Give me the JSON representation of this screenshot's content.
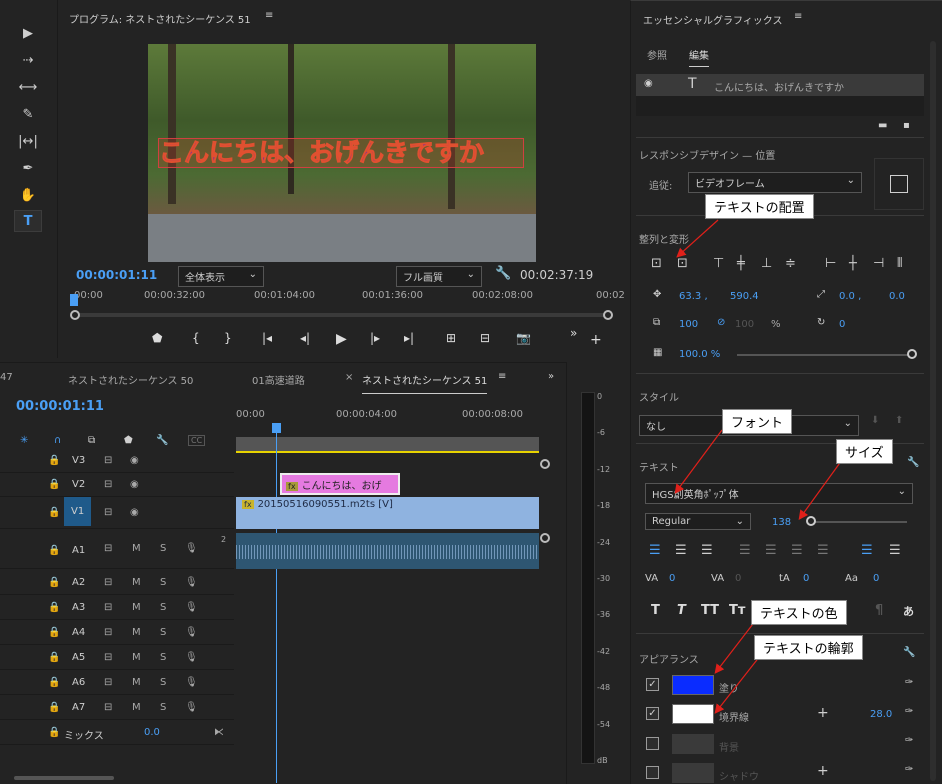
{
  "program": {
    "title": "プログラム: ネストされたシーケンス 51",
    "timecode": "00:00:01:11",
    "zoom": "全体表示",
    "quality": "フル画質",
    "duration": "00:02:37:19",
    "ruler": [
      "00:00",
      "00:00:32:00",
      "00:01:04:00",
      "00:01:36:00",
      "00:02:08:00",
      "00:02"
    ],
    "overlay_text": "こんにちは、おげんきですか"
  },
  "timeline": {
    "tabs": [
      "47",
      "ネストされたシーケンス 50",
      "01高速道路",
      "ネストされたシーケンス 51"
    ],
    "close": "×",
    "timecode": "00:00:01:11",
    "ruler": [
      "00:00",
      "00:00:04:00",
      "00:00:08:00"
    ],
    "cc": "CC",
    "tracks": [
      "V3",
      "V2",
      "V1",
      "A1",
      "A2",
      "A3",
      "A4",
      "A5",
      "A6",
      "A7"
    ],
    "mix_label": "ミックス",
    "mix_value": "0.0",
    "m": "M",
    "s": "S",
    "a1_ch": "2",
    "clip_title": "こんにちは、おげ",
    "clip_video": "20150516090551.m2ts [V]",
    "fx": "fx"
  },
  "meter": {
    "ticks": [
      "0",
      "-6",
      "-12",
      "-18",
      "-24",
      "-30",
      "-36",
      "-42",
      "-48",
      "-54",
      "dB"
    ]
  },
  "essential": {
    "title": "エッセンシャルグラフィックス",
    "tabs": [
      "参照",
      "編集"
    ],
    "layer": "こんにちは、おげんきですか",
    "responsive": "レスポンシブデザイン — 位置",
    "pin_label": "追従:",
    "pin_value": "ビデオフレーム",
    "align_title": "整列と変形",
    "pos_x": "63.3 ,",
    "pos_y": "590.4",
    "anchor_x": "0.0 ,",
    "anchor_y": "0.0",
    "scale": "100",
    "scale2": "100",
    "pct": "%",
    "rotation": "0",
    "opacity": "100.0 %",
    "style_title": "スタイル",
    "style_value": "なし",
    "text_title": "テキスト",
    "font": "HGS創英角ﾎﾟｯﾌﾟ体",
    "weight": "Regular",
    "size": "138",
    "kern": [
      "0",
      "0",
      "0",
      "0"
    ],
    "appearance_title": "アピアランス",
    "fill": "塗り",
    "stroke": "境界線",
    "stroke_width": "28.0",
    "bg": "背景",
    "shadow": "シャドウ",
    "fill_color": "#0a2cff",
    "stroke_color": "#ffffff"
  },
  "callouts": [
    "テキストの配置",
    "フォント",
    "サイズ",
    "テキストの色",
    "テキストの輪郭"
  ]
}
